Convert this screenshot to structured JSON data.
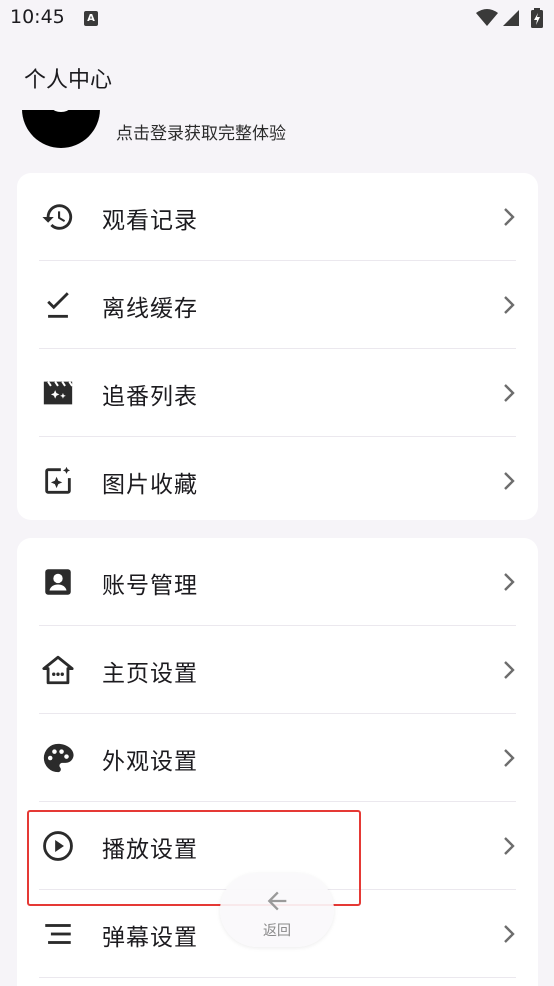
{
  "status_bar": {
    "time": "10:45",
    "notification_letter": "A"
  },
  "header": {
    "title": "个人中心",
    "login_hint": "点击登录获取完整体验"
  },
  "menu_group_1": [
    {
      "label": "观看记录",
      "icon": "history-icon"
    },
    {
      "label": "离线缓存",
      "icon": "download-check-icon"
    },
    {
      "label": "追番列表",
      "icon": "clapperboard-icon"
    },
    {
      "label": "图片收藏",
      "icon": "image-sparkle-icon"
    }
  ],
  "menu_group_2": [
    {
      "label": "账号管理",
      "icon": "account-box-icon"
    },
    {
      "label": "主页设置",
      "icon": "home-icon"
    },
    {
      "label": "外观设置",
      "icon": "palette-icon"
    },
    {
      "label": "播放设置",
      "icon": "play-circle-icon"
    },
    {
      "label": "弹幕设置",
      "icon": "danmaku-lines-icon"
    }
  ],
  "back_button": {
    "label": "返回"
  },
  "colors": {
    "background": "#f6f4f8",
    "card": "#ffffff",
    "highlight": "#e53935",
    "text": "#1c1b1f"
  }
}
